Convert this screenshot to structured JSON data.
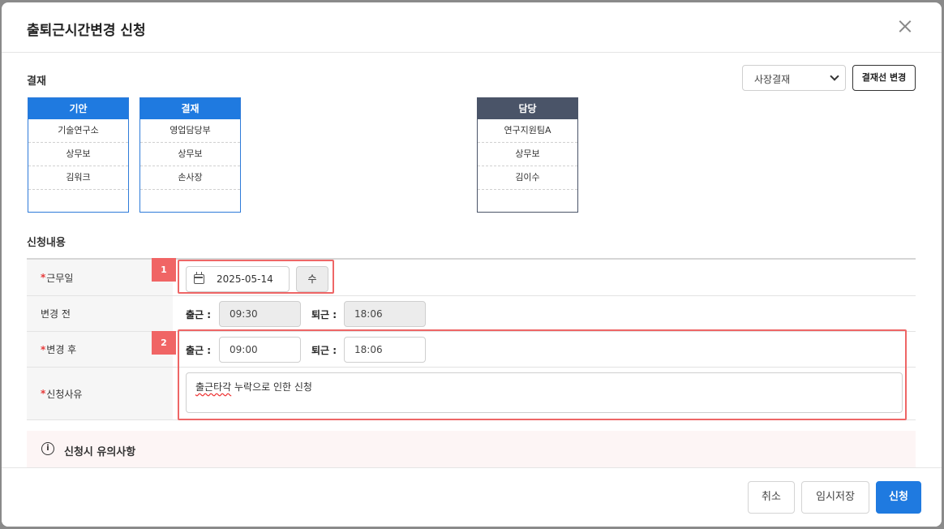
{
  "modal": {
    "title": "출퇴근시간변경 신청"
  },
  "approval": {
    "section_label": "결재",
    "line_select": "사장결재",
    "change_line_button": "결재선 변경",
    "boxes": [
      {
        "head": "기안",
        "cells": [
          "기술연구소",
          "상무보",
          "김워크",
          ""
        ]
      },
      {
        "head": "결재",
        "cells": [
          "영업담당부",
          "상무보",
          "손사장",
          ""
        ]
      },
      {
        "head": "담당",
        "cells": [
          "연구지원팀A",
          "상무보",
          "김이수",
          ""
        ]
      }
    ]
  },
  "request": {
    "section_label": "신청내용",
    "work_date": {
      "required_mark": "*",
      "label": "근무일",
      "value": "2025-05-14",
      "weekday": "수"
    },
    "before": {
      "label": "변경 전",
      "in_label": "출근 :",
      "in_value": "09:30",
      "out_label": "퇴근 :",
      "out_value": "18:06"
    },
    "after": {
      "required_mark": "*",
      "label": "변경 후",
      "in_label": "출근 :",
      "in_value": "09:00",
      "out_label": "퇴근 :",
      "out_value": "18:06"
    },
    "reason": {
      "required_mark": "*",
      "label": "신청사유",
      "value_misspelled": "출근타각",
      "value_rest": " 누락으로 인한 신청"
    }
  },
  "highlights": {
    "badge1": "1",
    "badge2": "2",
    "color": "#f06565"
  },
  "notice": {
    "icon": "i",
    "text": "신청시 유의사항"
  },
  "footer": {
    "cancel": "취소",
    "save_draft": "임시저장",
    "submit": "신청"
  },
  "colors": {
    "primary": "#1f7ae0",
    "dark_header": "#4a5468",
    "required": "#e63b3b"
  }
}
